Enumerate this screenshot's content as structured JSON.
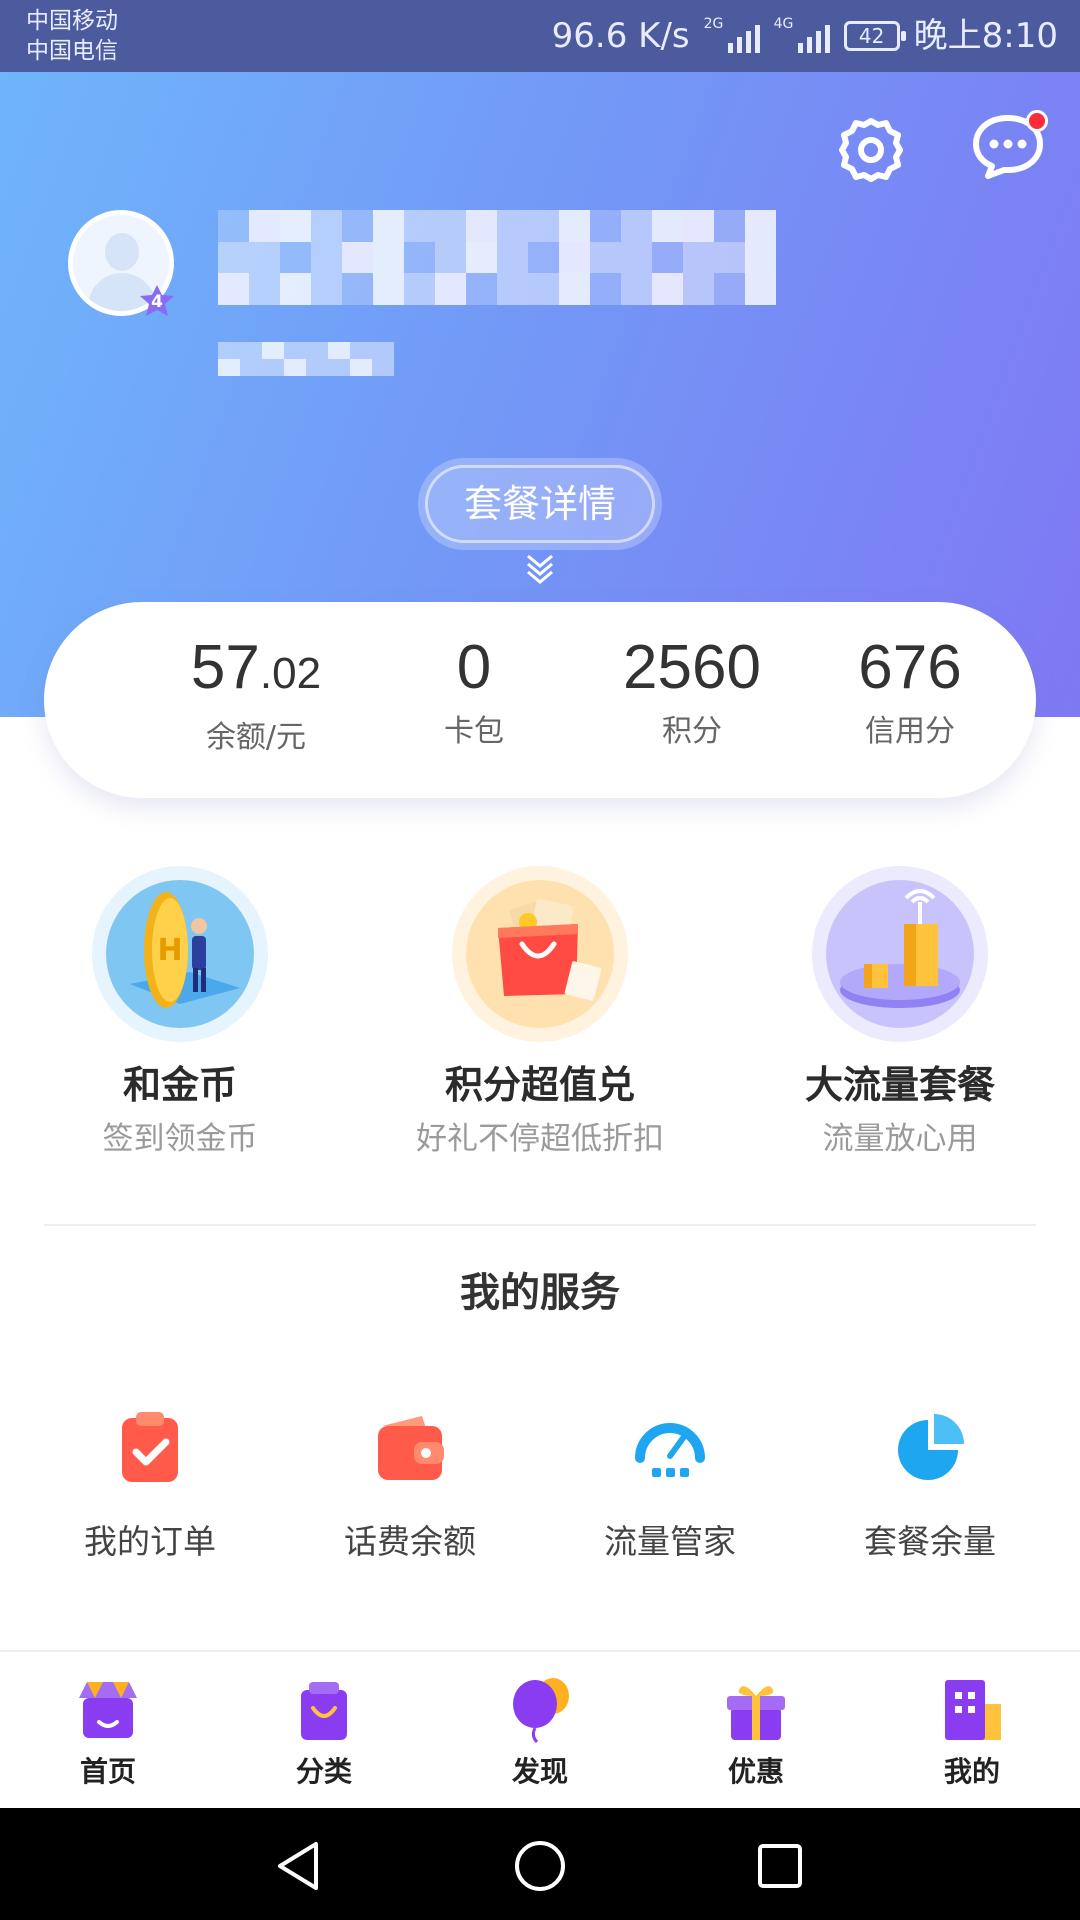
{
  "status_bar": {
    "carrier_1": "中国移动",
    "carrier_2": "中国电信",
    "speed": "96.6 K/s",
    "network_1": "2G",
    "network_2": "4G",
    "battery": "42",
    "time": "晚上8:10"
  },
  "header": {
    "level": "4",
    "package_button": "套餐详情"
  },
  "stats": [
    {
      "value_main": "57",
      "value_decimal": ".02",
      "label": "余额/元"
    },
    {
      "value_main": "0",
      "value_decimal": "",
      "label": "卡包"
    },
    {
      "value_main": "2560",
      "value_decimal": "",
      "label": "积分"
    },
    {
      "value_main": "676",
      "value_decimal": "",
      "label": "信用分"
    }
  ],
  "features": [
    {
      "title": "和金币",
      "subtitle": "签到领金币"
    },
    {
      "title": "积分超值兑",
      "subtitle": "好礼不停超低折扣"
    },
    {
      "title": "大流量套餐",
      "subtitle": "流量放心用"
    }
  ],
  "services": {
    "title": "我的服务",
    "items": [
      {
        "label": "我的订单",
        "icon": "order-clipboard-icon"
      },
      {
        "label": "话费余额",
        "icon": "wallet-icon"
      },
      {
        "label": "流量管家",
        "icon": "speedometer-icon"
      },
      {
        "label": "套餐余量",
        "icon": "pie-chart-icon"
      }
    ]
  },
  "bottom_nav": [
    {
      "label": "首页",
      "icon": "store-icon"
    },
    {
      "label": "分类",
      "icon": "shopping-bag-icon"
    },
    {
      "label": "发现",
      "icon": "balloon-icon"
    },
    {
      "label": "优惠",
      "icon": "gift-icon"
    },
    {
      "label": "我的",
      "icon": "building-icon"
    }
  ],
  "colors": {
    "header_gradient_start": "#6fb5fb",
    "header_gradient_end": "#7f78f3",
    "accent_purple": "#8a3cf0",
    "accent_red": "#ff5a4a",
    "accent_blue": "#1ea7f0"
  }
}
